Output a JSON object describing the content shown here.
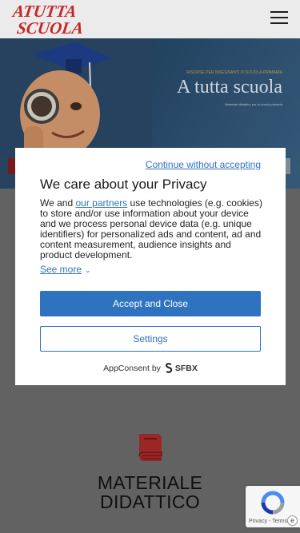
{
  "header": {
    "logo_text": "A TUTTA SCUOLA",
    "menu_icon": "hamburger-menu-icon"
  },
  "hero": {
    "tagline": "RISORSE PER INSEGNANTI DI SCUOLA PRIMARIA",
    "title": "A tutta scuola",
    "subtitle": "Materiale didattico per la scuola primaria"
  },
  "section": {
    "icon": "book-icon",
    "title_line1": "MATERIALE",
    "title_line2": "DIDATTICO"
  },
  "consent": {
    "continue_label": "Continue without accepting",
    "title": "We care about your Privacy",
    "text_before_link": "We and ",
    "partners_link": "our partners",
    "text_after_link": " use technologies (e.g. cookies) to store and/or use information about your device and we process personal device data (e.g. unique identifiers) for personalized ads and content, ad and content measurement, audience insights and product development.",
    "see_more": "See more",
    "accept_label": "Accept and Close",
    "settings_label": "Settings",
    "powered_by": "AppConsent by",
    "brand": "SFBX"
  },
  "recaptcha": {
    "privacy": "Privacy",
    "separator": " - ",
    "terms": "Terms"
  },
  "colors": {
    "accent": "#2f72c0",
    "logo_red": "#d42a2a",
    "backdrop": "#6b6b6b",
    "book": "#b02a2a"
  }
}
